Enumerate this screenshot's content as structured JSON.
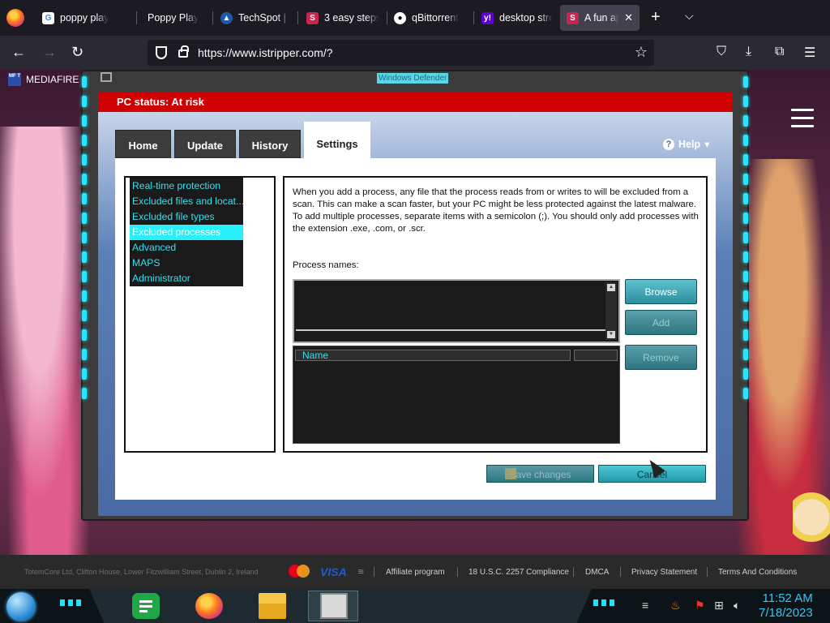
{
  "browser": {
    "tabs": [
      {
        "label": "poppy play",
        "favicon": "google-icon",
        "active": false
      },
      {
        "label": "Poppy Play",
        "favicon": "none",
        "active": false
      },
      {
        "label": "TechSpot | T",
        "favicon": "techspot-icon",
        "active": false
      },
      {
        "label": "3 easy steps",
        "favicon": "s-icon",
        "active": false
      },
      {
        "label": "qBittorrent",
        "favicon": "github-icon",
        "active": false
      },
      {
        "label": "desktop stre",
        "favicon": "yahoo-icon",
        "active": false
      },
      {
        "label": "A fun app",
        "favicon": "s-icon",
        "active": true
      }
    ],
    "url": "https://www.istripper.com/?",
    "bookmark": "MEDIAFIRE R",
    "bookmark_icon": "MF T"
  },
  "defender": {
    "window_title": "Windows Defender",
    "status": "PC status: At risk",
    "tabs": [
      "Home",
      "Update",
      "History",
      "Settings"
    ],
    "active_tab": "Settings",
    "help_label": "Help",
    "menu": [
      "Real-time protection",
      "Excluded files and locat...",
      "Excluded file types",
      "Excluded processes",
      "Advanced",
      "MAPS",
      "Administrator"
    ],
    "selected_menu": "Excluded processes",
    "description_1": "When you add a process, any file that the process reads from or writes to will be excluded from a scan. This can make a scan faster, but your PC might be less protected against the latest malware.",
    "description_2": "To add multiple processes, separate items with a semicolon (;). You should only add processes with the extension .exe, .com, or .scr.",
    "process_label": "Process names:",
    "process_value": "",
    "list_header": "Name",
    "buttons": {
      "browse": "Browse",
      "add": "Add",
      "remove": "Remove"
    },
    "save_label": "Save changes",
    "cancel_label": "Cancel"
  },
  "footer": {
    "copyright": "TotemCore Ltd, Clifton House, Lower Fitzwilliam Street, Dublin 2, Ireland",
    "visa": "VISA",
    "links": [
      "Affiliate program",
      "18 U.S.C. 2257 Compliance",
      "DMCA",
      "Privacy Statement",
      "Terms And Conditions"
    ]
  },
  "taskbar": {
    "time": "11:52 AM",
    "date": "7/18/2023"
  },
  "colors": {
    "status_red": "#d10000",
    "menu_cyan": "#37e0ec",
    "accent_teal": "#2c8e9e"
  }
}
